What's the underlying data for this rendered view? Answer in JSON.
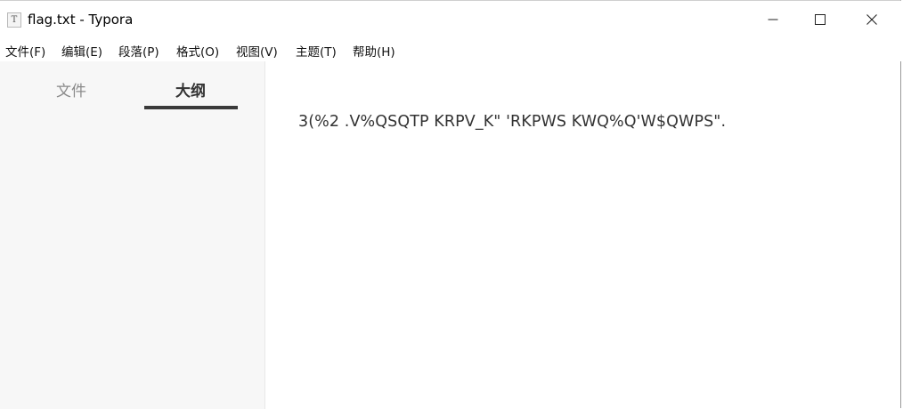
{
  "window": {
    "title": "flag.txt - Typora",
    "icon": "typora-text-file-icon",
    "icon_glyph": "T",
    "controls": [
      "minimize",
      "maximize",
      "close"
    ]
  },
  "menubar": {
    "items": [
      "文件(F)",
      "编辑(E)",
      "段落(P)",
      "格式(O)",
      "视图(V)",
      "主题(T)",
      "帮助(H)"
    ]
  },
  "sidebar": {
    "tabs": [
      {
        "label": "文件",
        "active": false
      },
      {
        "label": "大纲",
        "active": true
      }
    ]
  },
  "editor": {
    "content": "3(%2 .V%QSQTP KRPV_K\" 'RKPWS KWQ%Q'W$QWPS\"."
  },
  "colors": {
    "sidebar_bg": "#f7f7f7",
    "active_tab_underline": "#3a3a3a",
    "text": "#333333"
  }
}
